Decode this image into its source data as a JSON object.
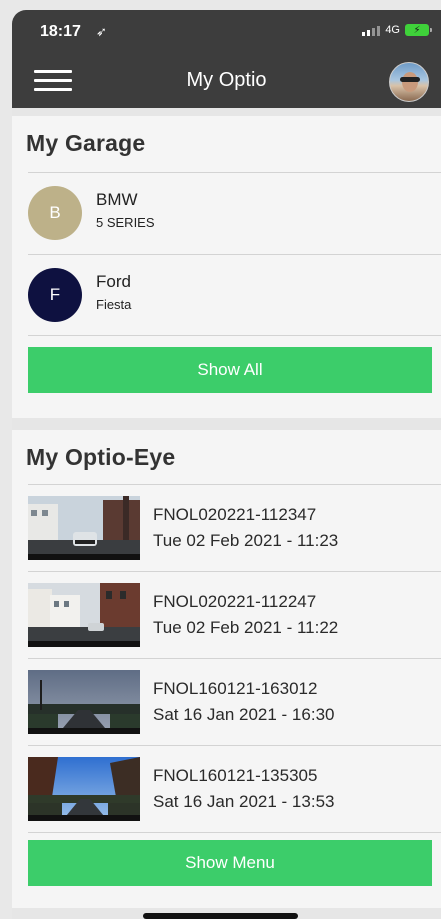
{
  "status_bar": {
    "time": "18:17",
    "location_glyph": "➶",
    "network": "4G",
    "battery_glyph": "⚡"
  },
  "nav": {
    "title": "My Optio",
    "menu_icon": "hamburger-menu-icon",
    "avatar_icon": "profile-avatar"
  },
  "garage": {
    "title": "My Garage",
    "vehicles": [
      {
        "initial": "B",
        "make": "BMW",
        "model": "5 SERIES",
        "color": "#bdb189"
      },
      {
        "initial": "F",
        "make": "Ford",
        "model": "Fiesta",
        "color": "#0e1140"
      }
    ],
    "show_all_label": "Show All"
  },
  "optio_eye": {
    "title": "My Optio-Eye",
    "clips": [
      {
        "id": "FNOL020221-112347",
        "date": "Tue 02 Feb 2021 - 11:23"
      },
      {
        "id": "FNOL020221-112247",
        "date": "Tue 02 Feb 2021 - 11:22"
      },
      {
        "id": "FNOL160121-163012",
        "date": "Sat 16 Jan 2021 - 16:30"
      },
      {
        "id": "FNOL160121-135305",
        "date": "Sat 16 Jan 2021 - 13:53"
      }
    ],
    "show_menu_label": "Show Menu"
  },
  "colors": {
    "nav_bg": "#3d3d3d",
    "accent_green": "#3ccd6a",
    "card_bg": "#f5f5f5"
  }
}
